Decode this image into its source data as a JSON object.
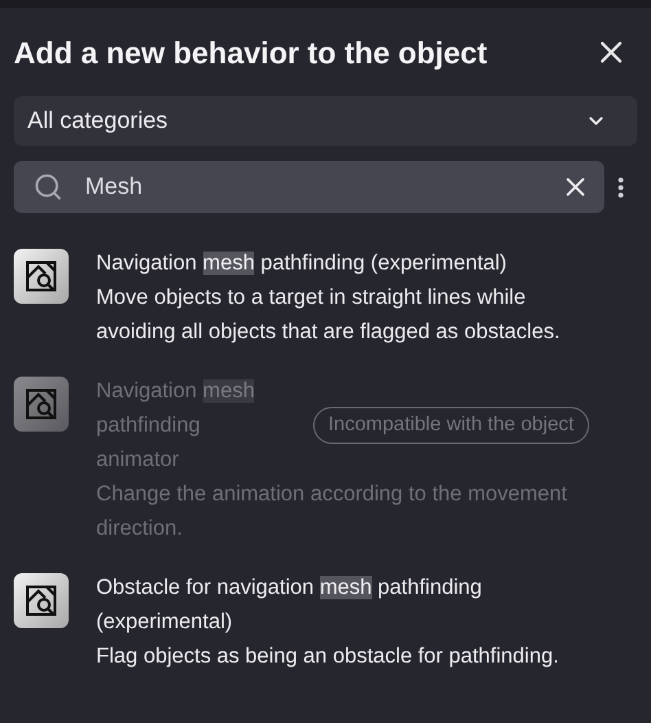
{
  "dialog": {
    "title": "Add a new behavior to the object"
  },
  "category_select": {
    "value": "All categories"
  },
  "search": {
    "value": "Mesh"
  },
  "behaviors": [
    {
      "title": {
        "before": "Navigation ",
        "match": "mesh",
        "after": " pathfinding (experimental)"
      },
      "description": "Move objects to a target in straight lines while avoiding all objects that are flagged as obstacles.",
      "disabled": false
    },
    {
      "title": {
        "before": "Navigation ",
        "match": "mesh",
        "after": " pathfinding animator"
      },
      "description": "Change the animation according to the movement direction.",
      "disabled": true,
      "badge": "Incompatible with the object"
    },
    {
      "title": {
        "before": "Obstacle for navigation ",
        "match": "mesh",
        "after": " pathfinding (experimental)"
      },
      "description": "Flag objects as being an obstacle for pathfinding.",
      "disabled": false
    }
  ]
}
